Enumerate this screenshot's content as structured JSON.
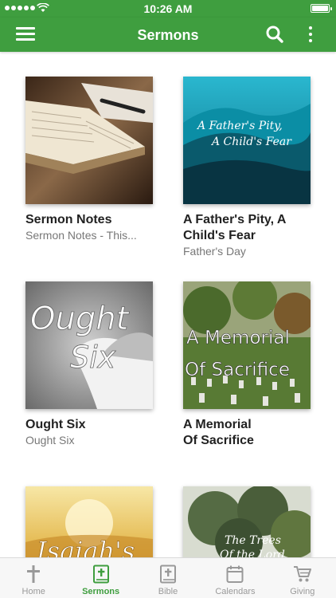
{
  "status_bar": {
    "time": "10:26 AM"
  },
  "app_bar": {
    "title": "Sermons"
  },
  "sermons": [
    {
      "title": "Sermon Notes",
      "subtitle": "Sermon Notes - This..."
    },
    {
      "title": "A Father's Pity, A Child's Fear",
      "subtitle": "Father's Day",
      "art_text_1": "A Father's Pity,",
      "art_text_2": "A Child's Fear"
    },
    {
      "title": "Ought Six",
      "subtitle": "Ought Six",
      "art_text_1": "Ought",
      "art_text_2": "Six"
    },
    {
      "title": "A Memorial Of Sacrifice",
      "title_line1": "A Memorial",
      "title_line2": "Of Sacrifice",
      "art_text_1": "A Memorial",
      "art_text_2": "Of Sacrifice"
    },
    {
      "art_text_1": "Isaiah's"
    },
    {
      "art_text_1": "The Trees",
      "art_text_2": "Of the Lord"
    }
  ],
  "tabs": [
    {
      "label": "Home",
      "icon": "cross-icon",
      "active": false
    },
    {
      "label": "Sermons",
      "icon": "bible-icon",
      "active": true
    },
    {
      "label": "Bible",
      "icon": "bible-icon",
      "active": false
    },
    {
      "label": "Calendars",
      "icon": "calendar-icon",
      "active": false
    },
    {
      "label": "Giving",
      "icon": "cart-icon",
      "active": false
    }
  ],
  "colors": {
    "brand": "#3f9e3f",
    "tab_inactive": "#999999",
    "title_text": "#222222",
    "subtitle_text": "#777777"
  }
}
